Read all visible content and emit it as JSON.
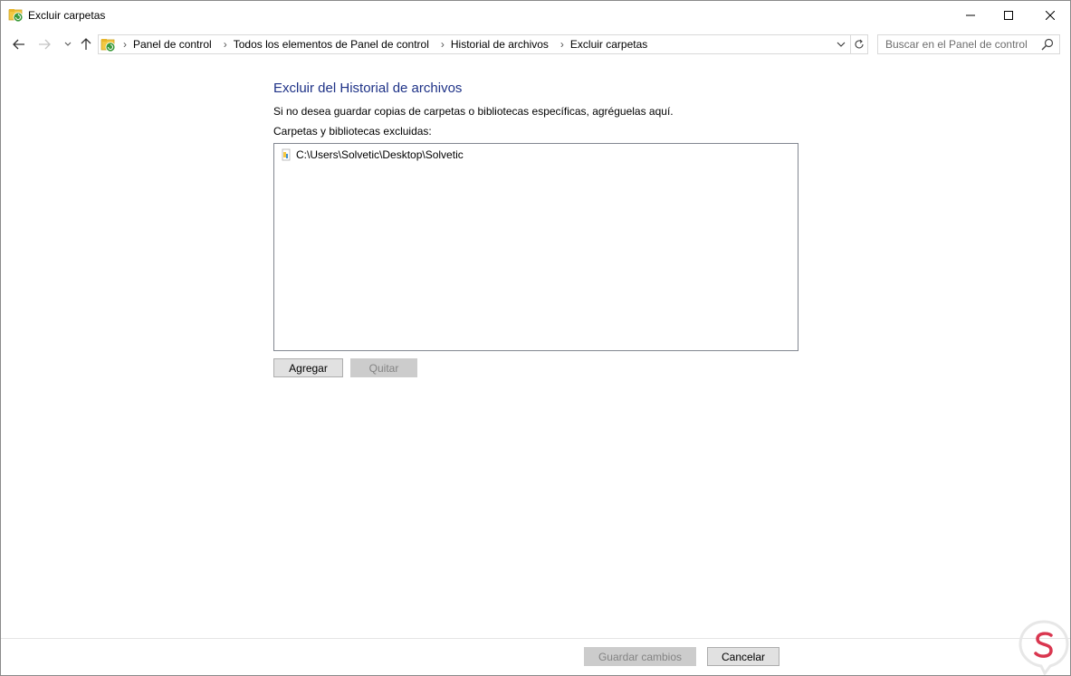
{
  "window": {
    "title": "Excluir carpetas"
  },
  "navigation": {
    "breadcrumbs": [
      "Panel de control",
      "Todos los elementos de Panel de control",
      "Historial de archivos",
      "Excluir carpetas"
    ],
    "search_placeholder": "Buscar en el Panel de control"
  },
  "main": {
    "heading": "Excluir del Historial de archivos",
    "description": "Si no desea guardar copias de carpetas o bibliotecas específicas, agréguelas aquí.",
    "list_label": "Carpetas y bibliotecas excluidas:",
    "excluded_items": [
      "C:\\Users\\Solvetic\\Desktop\\Solvetic"
    ],
    "add_button": "Agregar",
    "remove_button": "Quitar"
  },
  "footer": {
    "save_button": "Guardar cambios",
    "cancel_button": "Cancelar"
  },
  "colors": {
    "heading": "#1e3287",
    "watermark": "#d9364f"
  }
}
